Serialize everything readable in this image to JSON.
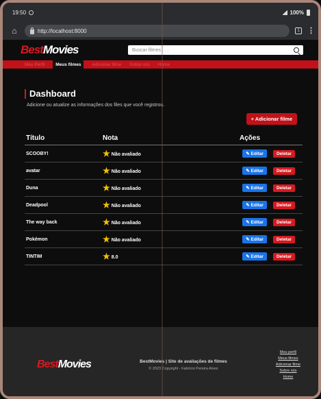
{
  "status": {
    "time": "19:50",
    "battery": "100%"
  },
  "browser": {
    "url": "http://localhost:8000",
    "tabs_count": "1"
  },
  "header": {
    "logo_best": "Best",
    "logo_movies": "Movies",
    "search_placeholder": "Buscar filmes . . ."
  },
  "nav": {
    "items": [
      {
        "label": "Meu Perfil",
        "active": false
      },
      {
        "label": "Meus filmes",
        "active": true
      },
      {
        "label": "Adicionar filme",
        "active": false
      },
      {
        "label": "Sobre nós",
        "active": false
      },
      {
        "label": "Home",
        "active": false
      }
    ]
  },
  "main": {
    "title": "Dashboard",
    "subtitle": "Adicione ou atualize as informações dos files que você registrou.",
    "add_button": "+ Adicionar filme",
    "table": {
      "headers": [
        "Título",
        "Nota",
        "Ações"
      ],
      "edit_label": "Editar",
      "delete_label": "Deletar",
      "rows": [
        {
          "title": "SCOOBY!",
          "nota": "Não avaliado"
        },
        {
          "title": "avatar",
          "nota": "Não avaliado"
        },
        {
          "title": "Duna",
          "nota": "Não avaliado"
        },
        {
          "title": "Deadpool",
          "nota": "Não avaliado"
        },
        {
          "title": "The way back",
          "nota": "Não avaliado"
        },
        {
          "title": "Pokémon",
          "nota": "Não avaliado"
        },
        {
          "title": "TINTIM",
          "nota": "8.0"
        }
      ]
    }
  },
  "footer": {
    "logo_best": "Best",
    "logo_movies": "Movies",
    "tagline": "BestMovies | Site de avaliações de filmes",
    "copyright": "© 2023 Copyright - Fabricio Pereira Alves",
    "links": [
      "Meu perfil",
      "Meus filmes",
      "Adicionar filme",
      "Sobre nós",
      "Home"
    ]
  },
  "colors": {
    "brand_red": "#c1121a",
    "edit_blue": "#1a74e8",
    "star": "#f2c200"
  }
}
